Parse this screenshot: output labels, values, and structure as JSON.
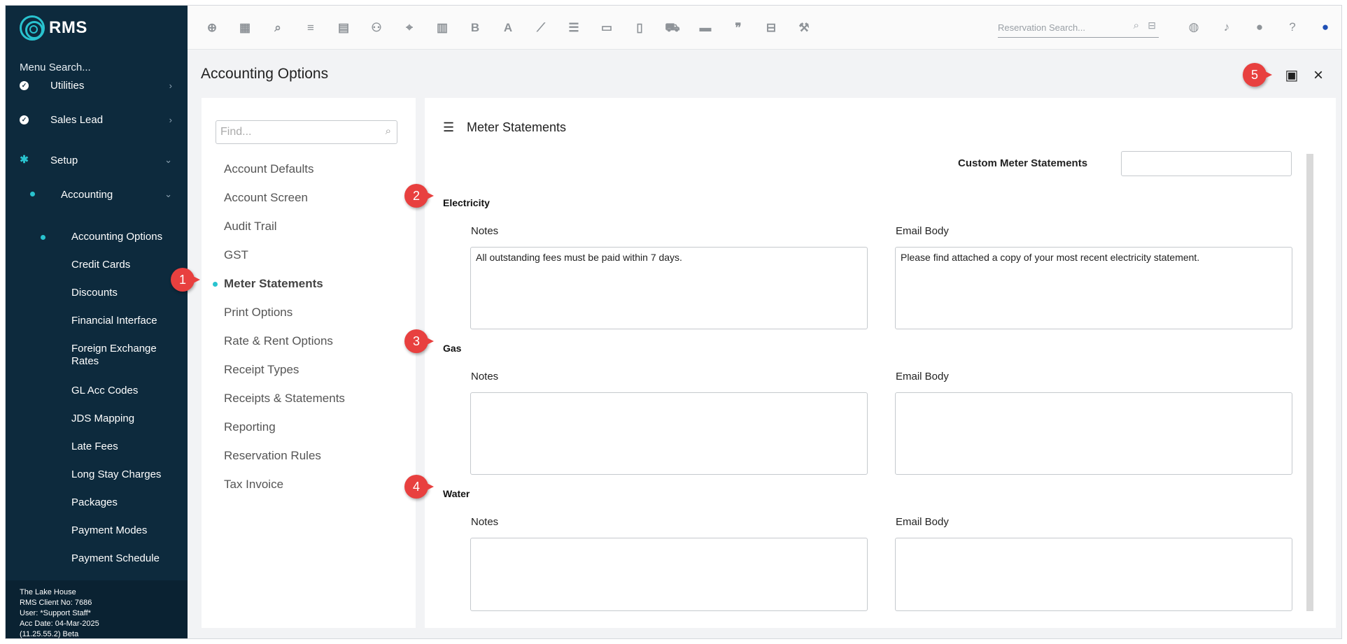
{
  "app": {
    "logo_text": "RMS",
    "menu_search_label": "Menu Search..."
  },
  "sidebar": {
    "items": [
      {
        "label": "Utilities",
        "icon": "utilities-icon"
      },
      {
        "label": "Sales Lead",
        "icon": "check-circle-icon"
      },
      {
        "label": "Setup",
        "icon": "gear-icon"
      }
    ],
    "accounting": {
      "label": "Accounting",
      "children": [
        "Accounting Options",
        "Credit Cards",
        "Discounts",
        "Financial Interface",
        "Foreign Exchange Rates",
        "GL Acc Codes",
        "JDS Mapping",
        "Late Fees",
        "Long Stay Charges",
        "Packages",
        "Payment Modes",
        "Payment Schedule"
      ]
    },
    "footer": {
      "property": "The Lake House",
      "client_no": "RMS Client No: 7686",
      "user": "User: *Support Staff*",
      "acc_date": "Acc Date: 04-Mar-2025",
      "version": "(11.25.55.2)  Beta"
    }
  },
  "toolbar": {
    "icons": [
      "add-icon",
      "calendar-icon",
      "search-icon",
      "filters-icon",
      "grid-icon",
      "guests-icon",
      "map-pin-icon",
      "map-icon",
      "bold-icon",
      "text-icon",
      "chart-icon",
      "checklist-icon",
      "card-icon",
      "report-icon",
      "cart-icon",
      "bill-icon",
      "quote-icon",
      "bed-icon",
      "hammer-icon"
    ],
    "reservation_search_placeholder": "Reservation Search...",
    "right_icons": [
      "globe-icon",
      "bell-icon",
      "chat-icon",
      "help-icon",
      "user-icon"
    ]
  },
  "page": {
    "title": "Accounting Options"
  },
  "options_panel": {
    "find_placeholder": "Find...",
    "items": [
      "Account Defaults",
      "Account Screen",
      "Audit Trail",
      "GST",
      "Meter Statements",
      "Print Options",
      "Rate & Rent Options",
      "Receipt Types",
      "Receipts & Statements",
      "Reporting",
      "Reservation Rules",
      "Tax Invoice"
    ],
    "active_index": 4
  },
  "main": {
    "section_title": "Meter Statements",
    "custom_label": "Custom Meter Statements",
    "custom_value": "",
    "notes_label": "Notes",
    "email_label": "Email Body",
    "groups": [
      {
        "title": "Electricity",
        "notes": "All outstanding fees must be paid within 7 days.",
        "email": "Please find attached a copy of your most recent electricity statement."
      },
      {
        "title": "Gas",
        "notes": "",
        "email": ""
      },
      {
        "title": "Water",
        "notes": "",
        "email": ""
      }
    ]
  },
  "callouts": [
    "1",
    "2",
    "3",
    "4",
    "5"
  ],
  "colors": {
    "sidebar_bg": "#0d2a3d",
    "accent": "#29c3cf",
    "callout": "#e8403f"
  }
}
